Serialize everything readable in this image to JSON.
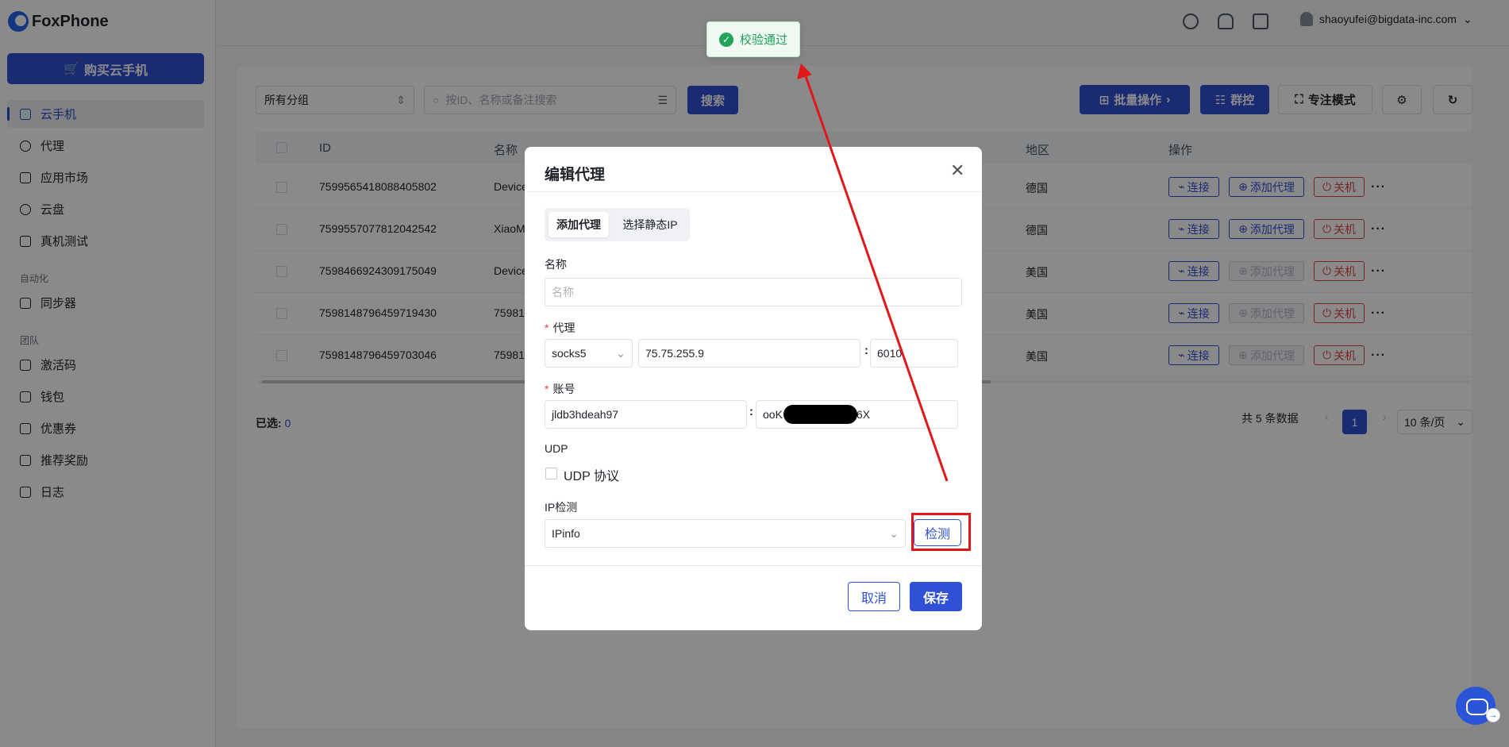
{
  "app": {
    "brand": "FoxPhone",
    "buy_button": "购买云手机"
  },
  "sidebar": {
    "items": [
      {
        "label": "云手机"
      },
      {
        "label": "代理"
      },
      {
        "label": "应用市场"
      },
      {
        "label": "云盘"
      },
      {
        "label": "真机测试"
      }
    ],
    "group_automation": "自动化",
    "automation_items": [
      {
        "label": "同步器"
      }
    ],
    "group_team": "团队",
    "team_items": [
      {
        "label": "激活码"
      },
      {
        "label": "钱包"
      },
      {
        "label": "优惠券"
      },
      {
        "label": "推荐奖励"
      },
      {
        "label": "日志"
      }
    ]
  },
  "header": {
    "user_email": "shaoyufei@bigdata-inc.com"
  },
  "toolbar": {
    "group_select": "所有分组",
    "search_placeholder": "按ID、名称或备注搜索",
    "search_button": "搜索",
    "batch_button": "批量操作",
    "group_control_button": "群控",
    "focus_button": "专注模式"
  },
  "table": {
    "headers": {
      "id": "ID",
      "name": "名称",
      "region": "地区",
      "actions": "操作"
    },
    "rows": [
      {
        "id": "7599565418088405802",
        "name": "Device",
        "region": "德国",
        "proxy_enabled": true
      },
      {
        "id": "7599557077812042542",
        "name": "XiaoM",
        "region": "德国",
        "proxy_enabled": true
      },
      {
        "id": "7598466924309175049",
        "name": "Device",
        "region": "美国",
        "proxy_enabled": false
      },
      {
        "id": "7598148796459719430",
        "name": "75981",
        "region": "美国",
        "proxy_enabled": false
      },
      {
        "id": "7598148796459703046",
        "name": "75981",
        "region": "美国",
        "proxy_enabled": false
      }
    ],
    "action_connect": "连接",
    "action_add_proxy": "添加代理",
    "action_shutdown": "关机",
    "action_more": "···"
  },
  "footer": {
    "selected_label": "已选:",
    "selected_count": "0",
    "total": "共 5 条数据",
    "page": "1",
    "page_size": "10 条/页"
  },
  "modal": {
    "title": "编辑代理",
    "tabs": [
      "添加代理",
      "选择静态IP"
    ],
    "name_label": "名称",
    "name_placeholder": "名称",
    "proxy_label": "代理",
    "proxy_type": "socks5",
    "proxy_host": "75.75.255.9",
    "proxy_port": "6010",
    "account_label": "账号",
    "account_user": "jldb3hdeah97",
    "account_pass_prefix": "ooK",
    "account_pass_suffix": "6X",
    "udp_label": "UDP",
    "udp_checkbox": "UDP 协议",
    "ip_check_label": "IP检测",
    "ip_check_provider": "IPinfo",
    "detect_button": "检测",
    "cancel_button": "取消",
    "save_button": "保存"
  },
  "toast": {
    "text": "校验通过"
  },
  "colors": {
    "primary": "#3051d6",
    "danger": "#e24545",
    "success": "#22a55b",
    "annotation": "#e01818"
  }
}
